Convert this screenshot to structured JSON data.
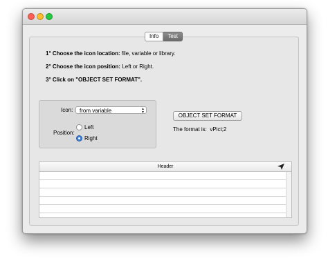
{
  "window": {
    "traffic_lights": {
      "close": "#ff5f57",
      "minimize": "#febc2e",
      "zoom": "#28c840"
    }
  },
  "tabs": [
    {
      "label": "Info",
      "active": false
    },
    {
      "label": "Test",
      "active": true
    }
  ],
  "instructions": [
    {
      "bold": "1° Choose the icon location:",
      "normal": " file, variable or library."
    },
    {
      "bold": "2° Choose the icon position:",
      "normal": " Left or Right."
    },
    {
      "bold": "3° Click on \"OBJECT SET FORMAT\".",
      "normal": ""
    }
  ],
  "form": {
    "icon_label": "Icon:",
    "icon_selected": "from variable",
    "position_label": "Position:",
    "position_options": [
      {
        "label": "Left",
        "selected": false
      },
      {
        "label": "Right",
        "selected": true
      }
    ]
  },
  "action": {
    "button_label": "OBJECT SET FORMAT",
    "result_label": "The format is:",
    "result_value": "vPict;2"
  },
  "table": {
    "header": "Header",
    "header_icon": "paper-plane-icon",
    "rows": [
      "",
      "",
      "",
      "",
      "",
      ""
    ]
  }
}
